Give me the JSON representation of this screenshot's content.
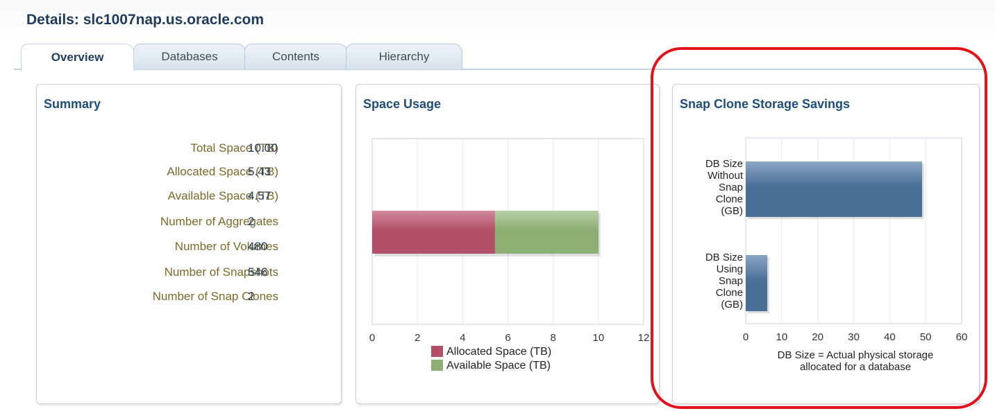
{
  "header": {
    "title": "Details: slc1007nap.us.oracle.com"
  },
  "tabs": [
    {
      "label": "Overview",
      "active": true
    },
    {
      "label": "Databases",
      "active": false
    },
    {
      "label": "Contents",
      "active": false
    },
    {
      "label": "Hierarchy",
      "active": false
    }
  ],
  "summary": {
    "title": "Summary",
    "rows": [
      {
        "label": "Total Space (TB)",
        "value": "10.00"
      },
      {
        "label": "Allocated Space (TB)",
        "value": "5.43"
      },
      {
        "label": "Available Space (TB)",
        "value": "4.57"
      },
      {
        "label": "Number of Aggregates",
        "value": "2"
      },
      {
        "label": "Number of Volumes",
        "value": "480"
      },
      {
        "label": "Number of Snapshots",
        "value": "546"
      },
      {
        "label": "Number of Snap Clones",
        "value": "2"
      }
    ]
  },
  "space_usage": {
    "title": "Space Usage",
    "chart_data": {
      "type": "bar",
      "orientation": "horizontal",
      "stacked": true,
      "categories": [
        ""
      ],
      "series": [
        {
          "name": "Allocated Space (TB)",
          "values": [
            5.43
          ],
          "color": "#b25069"
        },
        {
          "name": "Available Space (TB)",
          "values": [
            4.57
          ],
          "color": "#8daf73"
        }
      ],
      "xlim": [
        0,
        12
      ],
      "xticks": [
        "0",
        "2",
        "4",
        "6",
        "8",
        "10",
        "12"
      ],
      "grid": true,
      "legend": "bottom"
    }
  },
  "snap_clone": {
    "title": "Snap Clone Storage Savings",
    "chart_data": {
      "type": "bar",
      "orientation": "horizontal",
      "categories": [
        [
          "DB Size",
          "Without",
          "Snap",
          "Clone",
          "(GB)"
        ],
        [
          "DB Size",
          "Using",
          "Snap",
          "Clone",
          "(GB)"
        ]
      ],
      "values": [
        49,
        6
      ],
      "color": "#4a6f97",
      "xlim": [
        0,
        60
      ],
      "xticks": [
        "0",
        "10",
        "20",
        "30",
        "40",
        "50",
        "60"
      ],
      "grid": true,
      "caption": [
        "DB Size = Actual physical storage",
        "allocated for a database"
      ]
    }
  },
  "colors": {
    "highlight": "#e2111a",
    "title": "#1f4d7a",
    "label": "#7a6a2a"
  }
}
